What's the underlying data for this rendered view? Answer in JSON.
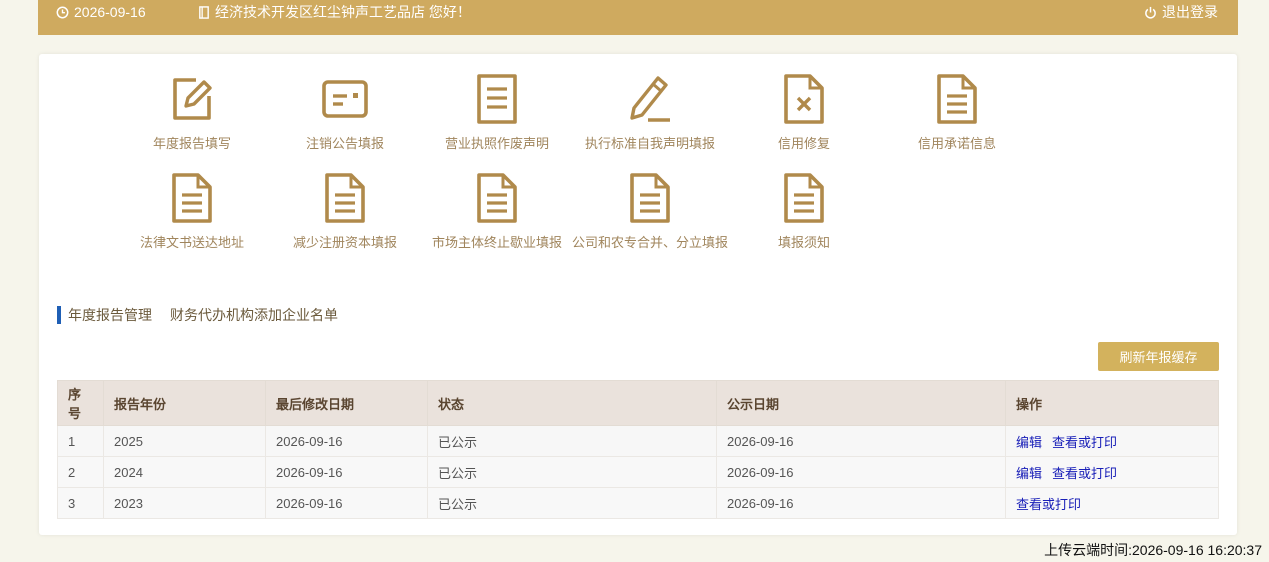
{
  "topbar": {
    "date": "2026-09-16",
    "greeting": "经济技术开发区红尘钟声工艺品店 您好！",
    "logout": "退出登录",
    "date_icon": "clock-icon",
    "shop_icon": "book-icon",
    "logout_icon": "power-icon"
  },
  "grid": [
    {
      "label": "年度报告填写",
      "icon": "edit-icon"
    },
    {
      "label": "注销公告填报",
      "icon": "card-icon"
    },
    {
      "label": "营业执照作废声明",
      "icon": "document-icon"
    },
    {
      "label": "执行标准自我声明填报",
      "icon": "pencil-icon"
    },
    {
      "label": "信用修复",
      "icon": "document-x-icon"
    },
    {
      "label": "信用承诺信息",
      "icon": "document-lines-icon"
    },
    {
      "label": "法律文书送达地址",
      "icon": "document-lines-icon"
    },
    {
      "label": "减少注册资本填报",
      "icon": "document-lines-icon"
    },
    {
      "label": "市场主体终止歇业填报",
      "icon": "document-lines-icon"
    },
    {
      "label": "公司和农专合并、分立填报",
      "icon": "document-lines-icon"
    },
    {
      "label": "填报须知",
      "icon": "document-lines-icon"
    }
  ],
  "tabs": [
    "年度报告管理",
    "财务代办机构添加企业名单"
  ],
  "refresh_button": "刷新年报缓存",
  "table": {
    "headers": [
      "序号",
      "报告年份",
      "最后修改日期",
      "状态",
      "公示日期",
      "操作"
    ],
    "rows": [
      {
        "no": "1",
        "year": "2025",
        "modified": "2026-09-16",
        "status": "已公示",
        "published": "2026-09-16",
        "actions": [
          "编辑",
          "查看或打印"
        ]
      },
      {
        "no": "2",
        "year": "2024",
        "modified": "2026-09-16",
        "status": "已公示",
        "published": "2026-09-16",
        "actions": [
          "编辑",
          "查看或打印"
        ]
      },
      {
        "no": "3",
        "year": "2023",
        "modified": "2026-09-16",
        "status": "已公示",
        "published": "2026-09-16",
        "actions": [
          "查看或打印"
        ]
      }
    ]
  },
  "upload_time": "上传云端时间:2026-09-16 16:20:37",
  "colors": {
    "accent": "#cfaa5f",
    "icon": "#b08a4b",
    "link": "#1a20b8",
    "tab_marker": "#1f5fb5"
  }
}
